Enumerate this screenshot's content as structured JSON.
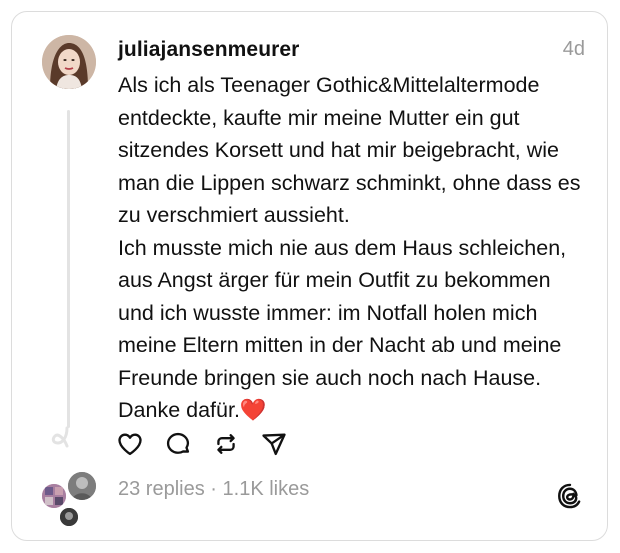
{
  "post": {
    "username": "juliajansenmeurer",
    "time": "4d",
    "paragraphs": [
      "Als ich als Teenager Gothic&Mittelaltermode entdeckte, kaufte mir meine Mutter ein gut sitzendes Korsett und hat mir beigebracht, wie man die Lippen schwarz schminkt, ohne dass es zu verschmiert aussieht.",
      "Ich musste mich nie aus dem Haus schleichen, aus Angst ärger für mein Outfit zu bekommen und ich wusste immer: im Notfall holen mich meine Eltern mitten in der Nacht ab und meine Freunde bringen sie auch noch nach Hause. Danke dafür."
    ],
    "emoji": "❤️"
  },
  "actions": {
    "like": "heart-icon",
    "reply": "comment-icon",
    "repost": "repost-icon",
    "share": "send-icon"
  },
  "stats": {
    "replies": "23 replies",
    "separator": "·",
    "likes": "1.1K likes"
  },
  "colors": {
    "text": "#111111",
    "muted": "#9a9a9a",
    "border": "#dcdcdc",
    "emoji_heart": "#e0245e"
  }
}
